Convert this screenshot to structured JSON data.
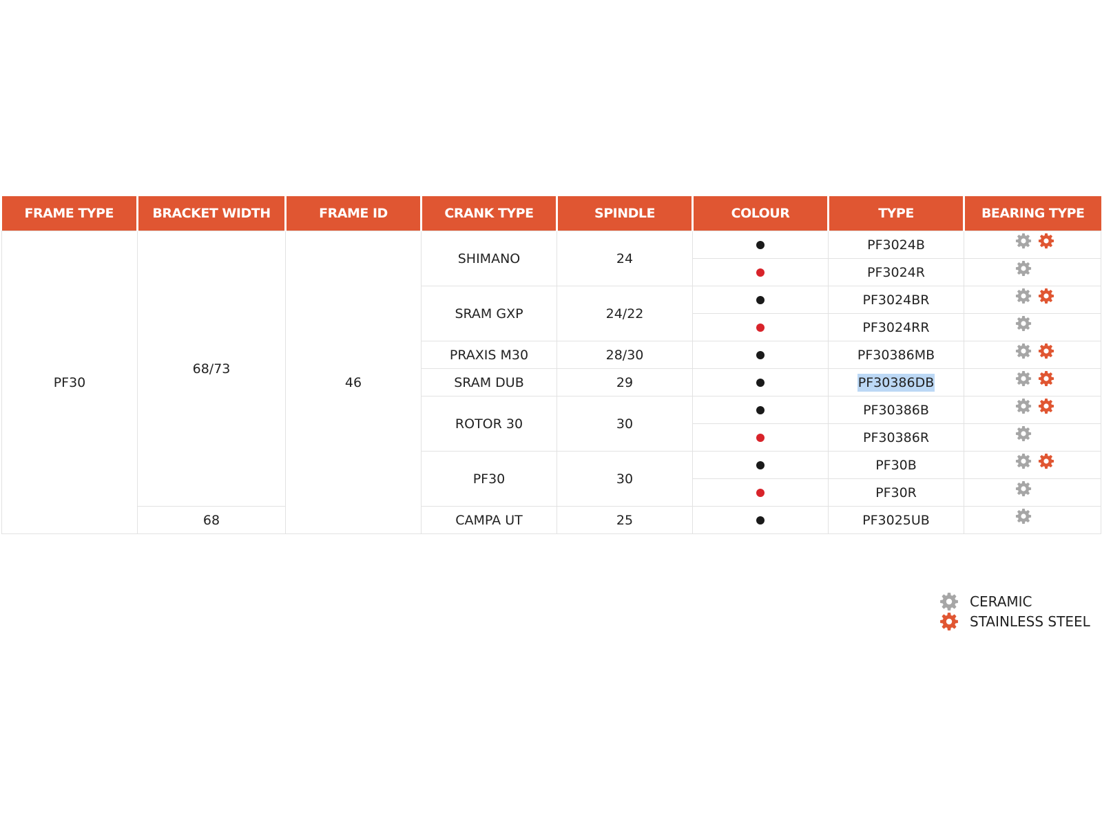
{
  "colors": {
    "header_bg": "#e05632",
    "header_text": "#ffffff",
    "black_dot": "#1a1a1a",
    "red_dot": "#d8232a",
    "ceramic_icon": "#a6a6a6",
    "stainless_icon": "#e05632",
    "highlight": "#bcd8f5"
  },
  "table": {
    "headers": [
      "FRAME TYPE",
      "BRACKET WIDTH",
      "FRAME ID",
      "CRANK TYPE",
      "SPINDLE",
      "COLOUR",
      "TYPE",
      "BEARING TYPE"
    ],
    "frame_type": "PF30",
    "bracket_widths": [
      "68/73",
      "68"
    ],
    "frame_id": "46",
    "crank_groups": [
      {
        "crank": "SHIMANO",
        "spindle": "24"
      },
      {
        "crank": "SRAM GXP",
        "spindle": "24/22"
      },
      {
        "crank": "PRAXIS M30",
        "spindle": "28/30"
      },
      {
        "crank": "SRAM DUB",
        "spindle": "29"
      },
      {
        "crank": "ROTOR 30",
        "spindle": "30"
      },
      {
        "crank": "PF30",
        "spindle": "30"
      },
      {
        "crank": "CAMPA UT",
        "spindle": "25"
      }
    ],
    "rows": [
      {
        "colour": "black",
        "type": "PF3024B",
        "bearings": [
          "ceramic",
          "stainless-steel"
        ]
      },
      {
        "colour": "red",
        "type": "PF3024R",
        "bearings": [
          "ceramic"
        ]
      },
      {
        "colour": "black",
        "type": "PF3024BR",
        "bearings": [
          "ceramic",
          "stainless-steel"
        ]
      },
      {
        "colour": "red",
        "type": "PF3024RR",
        "bearings": [
          "ceramic"
        ]
      },
      {
        "colour": "black",
        "type": "PF30386MB",
        "bearings": [
          "ceramic",
          "stainless-steel"
        ]
      },
      {
        "colour": "black",
        "type": "PF30386DB",
        "bearings": [
          "ceramic",
          "stainless-steel"
        ],
        "selected": true
      },
      {
        "colour": "black",
        "type": "PF30386B",
        "bearings": [
          "ceramic",
          "stainless-steel"
        ]
      },
      {
        "colour": "red",
        "type": "PF30386R",
        "bearings": [
          "ceramic"
        ]
      },
      {
        "colour": "black",
        "type": "PF30B",
        "bearings": [
          "ceramic",
          "stainless-steel"
        ]
      },
      {
        "colour": "red",
        "type": "PF30R",
        "bearings": [
          "ceramic"
        ]
      },
      {
        "colour": "black",
        "type": "PF3025UB",
        "bearings": [
          "ceramic"
        ]
      }
    ]
  },
  "legend": {
    "ceramic_label": "CERAMIC",
    "ceramic_icon": "gear-icon-grey",
    "stainless_label": "STAINLESS STEEL",
    "stainless_icon": "gear-icon-orange"
  }
}
